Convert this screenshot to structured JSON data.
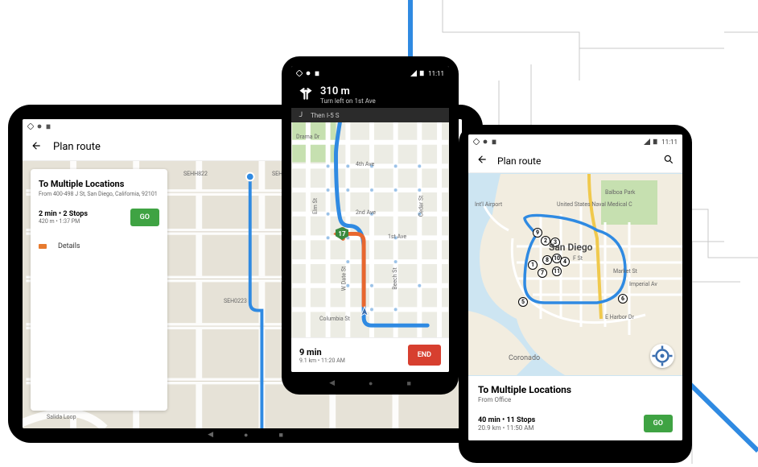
{
  "status": {
    "time": "11:11"
  },
  "tablet": {
    "header_title": "Plan route",
    "card": {
      "title": "To Multiple Locations",
      "from": "From 400-498 J St, San Diego, California, 92101",
      "duration_stops": "2 min • 2 Stops",
      "dist_eta": "420 m • 1:37 PM",
      "go": "GO",
      "details": "Details"
    }
  },
  "nav_phone": {
    "distance": "310 m",
    "instruction": "Turn left on 1st Ave",
    "then": "Then I-5 S",
    "shield": "17",
    "eta_time": "9 min",
    "eta_sub": "9.1 km • 11:20 AM",
    "end": "END",
    "streets": {
      "drama": "Drama Dr",
      "ave4": "4th Ave",
      "ave2": "2nd Ave",
      "ave1": "1st Ave",
      "elm": "Elm St",
      "date": "W Date St",
      "beech": "Beech St",
      "cedar": "Cedar St",
      "columbia": "Columbia St"
    }
  },
  "plan_phone": {
    "header_title": "Plan route",
    "card": {
      "title": "To Multiple Locations",
      "from": "From Office",
      "duration_stops": "40 min • 11 Stops",
      "dist_eta": "20.9 km • 11:50 AM",
      "go": "GO"
    },
    "labels": {
      "sandiego": "San Diego",
      "balboa": "Balboa Park",
      "naval": "United States Naval Medical C",
      "airport": "Int'l Airport",
      "fst": "F St",
      "market": "Market St",
      "imperial": "Imperial Av",
      "harbor": "E Harbor Dr",
      "coronado": "Coronado"
    }
  },
  "tablet_map_labels": {
    "salida": "Salida Loop"
  }
}
